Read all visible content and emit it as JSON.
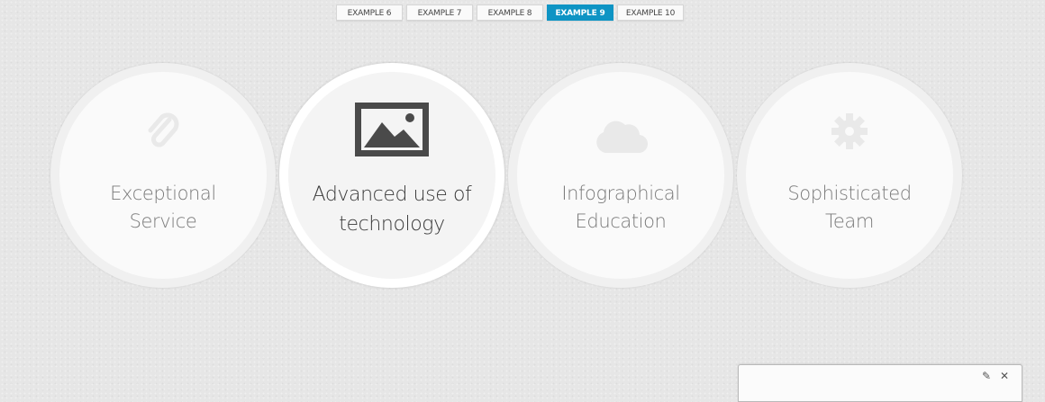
{
  "tabs": [
    {
      "label": "EXAMPLE 6",
      "active": false
    },
    {
      "label": "EXAMPLE 7",
      "active": false
    },
    {
      "label": "EXAMPLE 8",
      "active": false
    },
    {
      "label": "EXAMPLE 9",
      "active": true
    },
    {
      "label": "EXAMPLE 10",
      "active": false
    }
  ],
  "circles": [
    {
      "line1": "Exceptional",
      "line2": "Service",
      "icon": "paperclip-icon"
    },
    {
      "line1": "Advanced use of",
      "line2": "technology",
      "icon": "image-icon"
    },
    {
      "line1": "Infographical",
      "line2": "Education",
      "icon": "cloud-icon"
    },
    {
      "line1": "Sophisticated",
      "line2": "Team",
      "icon": "gear-icon"
    }
  ],
  "colors": {
    "accent": "#0e94c4",
    "icon_faint": "#e9e9e9",
    "icon_dark": "#4a4a4a"
  },
  "widget": {
    "title": "",
    "settings_glyph": "✎",
    "close_glyph": "✕"
  }
}
